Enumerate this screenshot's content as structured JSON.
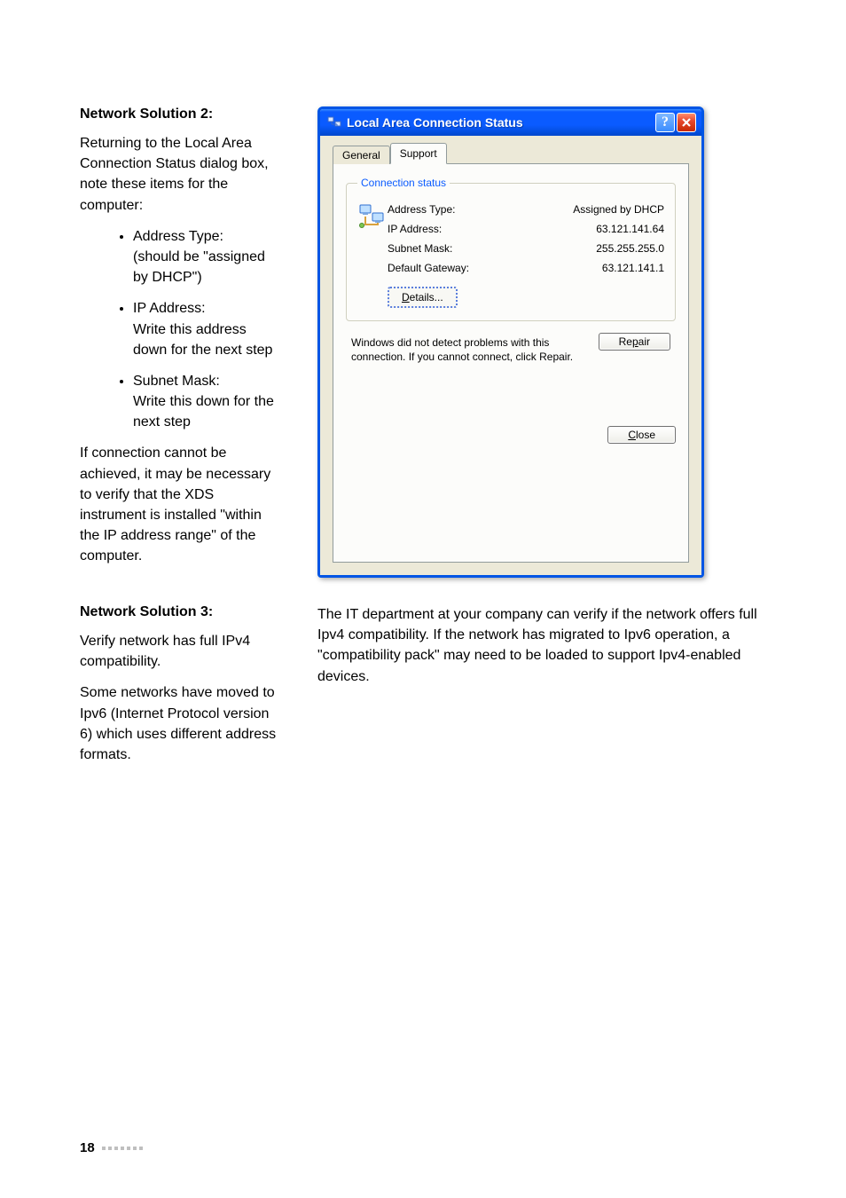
{
  "solution2": {
    "heading": "Network Solution 2:",
    "intro": "Returning to the Local Area Connection Status dialog box, note these items for the computer:",
    "bullets": [
      {
        "title": "Address Type:",
        "desc": "(should be \"assigned by DHCP\")"
      },
      {
        "title": "IP Address:",
        "desc": "Write this address down for the next step"
      },
      {
        "title": "Subnet Mask:",
        "desc": "Write this down for the next step"
      }
    ],
    "outro": "If connection cannot be achieved, it may be necessary to verify that the XDS instrument is installed \"within the IP address range\" of the computer."
  },
  "solution3": {
    "heading": "Network Solution 3:",
    "p1": "Verify network has full IPv4 compatibility.",
    "p2": "Some networks have moved to Ipv6 (Internet Protocol version 6) which uses different address formats.",
    "right": "The IT department at your company can verify if the network offers full Ipv4 compatibility. If the network has migrated to Ipv6 operation, a \"compatibility pack\" may need to be loaded to support Ipv4-enabled devices."
  },
  "dialog": {
    "title": "Local Area Connection Status",
    "tabs": {
      "general": "General",
      "support": "Support"
    },
    "legend": "Connection status",
    "rows": {
      "addrtype": {
        "label": "Address Type:",
        "value": "Assigned by DHCP"
      },
      "ip": {
        "label": "IP Address:",
        "value": "63.121.141.64"
      },
      "subnet": {
        "label": "Subnet Mask:",
        "value": "255.255.255.0"
      },
      "gateway": {
        "label": "Default Gateway:",
        "value": "63.121.141.1"
      }
    },
    "details_pre": "D",
    "details_post": "etails...",
    "repair_text": "Windows did not detect problems with this connection. If you cannot connect, click Repair.",
    "repair_pre": "Re",
    "repair_u": "p",
    "repair_post": "air",
    "close_u": "C",
    "close_post": "lose"
  },
  "footer": {
    "page": "18"
  }
}
